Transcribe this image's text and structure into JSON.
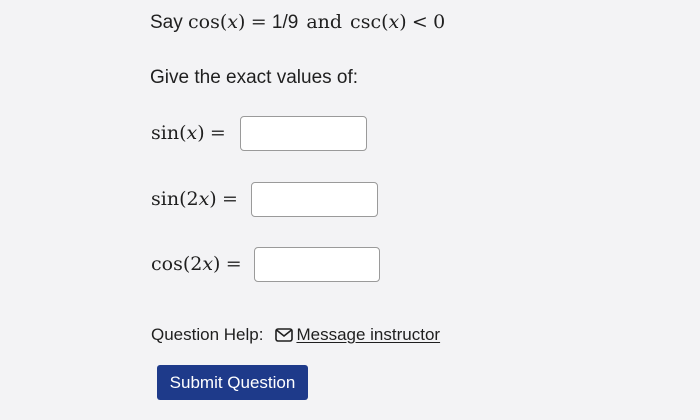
{
  "statement": {
    "say": "Say",
    "cos_expr": "cos(𝑥)",
    "equals": "=",
    "cos_value": "1/9",
    "and": "and",
    "csc_expr": "csc(𝑥)",
    "less_than": "<",
    "csc_bound": "0"
  },
  "prompt": "Give the exact values of:",
  "fields": [
    {
      "label": "sin(𝑥)",
      "equals": "=",
      "value": ""
    },
    {
      "label": "sin(2𝑥)",
      "equals": "=",
      "value": ""
    },
    {
      "label": "cos(2𝑥)",
      "equals": "=",
      "value": ""
    }
  ],
  "help": {
    "label": "Question Help:",
    "icon": "envelope-icon",
    "link_text": "Message instructor"
  },
  "submit_label": "Submit Question"
}
